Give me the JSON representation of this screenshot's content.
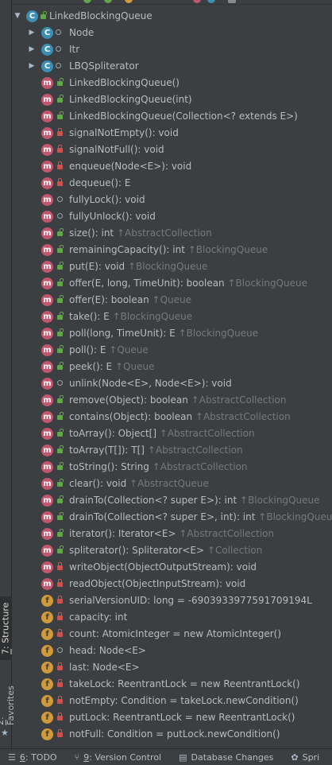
{
  "side_tabs": {
    "structure": {
      "num": "7",
      "label": ": Structure"
    },
    "favorites": {
      "num": "2",
      "label": ": Favorites"
    }
  },
  "root": {
    "label": "LinkedBlockingQueue"
  },
  "nested": [
    {
      "label": "Node",
      "badge": "C"
    },
    {
      "label": "Itr",
      "badge": "C"
    },
    {
      "label": "LBQSpliterator",
      "badge": "C"
    }
  ],
  "members": [
    {
      "kind": "m",
      "vis": "pub",
      "text": "LinkedBlockingQueue()",
      "inherit": ""
    },
    {
      "kind": "m",
      "vis": "pub",
      "text": "LinkedBlockingQueue(int)",
      "inherit": ""
    },
    {
      "kind": "m",
      "vis": "pub",
      "text": "LinkedBlockingQueue(Collection<? extends E>)",
      "inherit": ""
    },
    {
      "kind": "m",
      "vis": "priv",
      "text": "signalNotEmpty(): void",
      "inherit": ""
    },
    {
      "kind": "m",
      "vis": "priv",
      "text": "signalNotFull(): void",
      "inherit": ""
    },
    {
      "kind": "m",
      "vis": "priv",
      "text": "enqueue(Node<E>): void",
      "inherit": ""
    },
    {
      "kind": "m",
      "vis": "priv",
      "text": "dequeue(): E",
      "inherit": ""
    },
    {
      "kind": "m",
      "vis": "pkg",
      "text": "fullyLock(): void",
      "inherit": ""
    },
    {
      "kind": "m",
      "vis": "pkg",
      "text": "fullyUnlock(): void",
      "inherit": ""
    },
    {
      "kind": "m",
      "vis": "pub",
      "text": "size(): int",
      "inherit": "↑AbstractCollection"
    },
    {
      "kind": "m",
      "vis": "pub",
      "text": "remainingCapacity(): int",
      "inherit": "↑BlockingQueue"
    },
    {
      "kind": "m",
      "vis": "pub",
      "text": "put(E): void",
      "inherit": "↑BlockingQueue"
    },
    {
      "kind": "m",
      "vis": "pub",
      "text": "offer(E, long, TimeUnit): boolean",
      "inherit": "↑BlockingQueue"
    },
    {
      "kind": "m",
      "vis": "pub",
      "text": "offer(E): boolean",
      "inherit": "↑Queue"
    },
    {
      "kind": "m",
      "vis": "pub",
      "text": "take(): E",
      "inherit": "↑BlockingQueue"
    },
    {
      "kind": "m",
      "vis": "pub",
      "text": "poll(long, TimeUnit): E",
      "inherit": "↑BlockingQueue"
    },
    {
      "kind": "m",
      "vis": "pub",
      "text": "poll(): E",
      "inherit": "↑Queue"
    },
    {
      "kind": "m",
      "vis": "pub",
      "text": "peek(): E",
      "inherit": "↑Queue"
    },
    {
      "kind": "m",
      "vis": "pkg",
      "text": "unlink(Node<E>, Node<E>): void",
      "inherit": ""
    },
    {
      "kind": "m",
      "vis": "pub",
      "text": "remove(Object): boolean",
      "inherit": "↑AbstractCollection"
    },
    {
      "kind": "m",
      "vis": "pub",
      "text": "contains(Object): boolean",
      "inherit": "↑AbstractCollection"
    },
    {
      "kind": "m",
      "vis": "pub",
      "text": "toArray(): Object[]",
      "inherit": "↑AbstractCollection"
    },
    {
      "kind": "m",
      "vis": "pub",
      "text": "toArray(T[]): T[]",
      "inherit": "↑AbstractCollection"
    },
    {
      "kind": "m",
      "vis": "pub",
      "text": "toString(): String",
      "inherit": "↑AbstractCollection"
    },
    {
      "kind": "m",
      "vis": "pub",
      "text": "clear(): void",
      "inherit": "↑AbstractQueue"
    },
    {
      "kind": "m",
      "vis": "pub",
      "text": "drainTo(Collection<? super E>): int",
      "inherit": "↑BlockingQueue"
    },
    {
      "kind": "m",
      "vis": "pub",
      "text": "drainTo(Collection<? super E>, int): int",
      "inherit": "↑BlockingQueue"
    },
    {
      "kind": "m",
      "vis": "pub",
      "text": "iterator(): Iterator<E>",
      "inherit": "↑AbstractCollection"
    },
    {
      "kind": "m",
      "vis": "pub",
      "text": "spliterator(): Spliterator<E>",
      "inherit": "↑Collection"
    },
    {
      "kind": "m",
      "vis": "priv",
      "text": "writeObject(ObjectOutputStream): void",
      "inherit": ""
    },
    {
      "kind": "m",
      "vis": "priv",
      "text": "readObject(ObjectInputStream): void",
      "inherit": ""
    },
    {
      "kind": "f",
      "vis": "priv",
      "text": "serialVersionUID: long = -6903933977591709194L",
      "inherit": ""
    },
    {
      "kind": "f",
      "vis": "priv",
      "text": "capacity: int",
      "inherit": ""
    },
    {
      "kind": "f",
      "vis": "priv",
      "text": "count: AtomicInteger = new AtomicInteger()",
      "inherit": ""
    },
    {
      "kind": "f",
      "vis": "pkg",
      "text": "head: Node<E>",
      "inherit": ""
    },
    {
      "kind": "f",
      "vis": "priv",
      "text": "last: Node<E>",
      "inherit": ""
    },
    {
      "kind": "f",
      "vis": "priv",
      "text": "takeLock: ReentrantLock = new ReentrantLock()",
      "inherit": ""
    },
    {
      "kind": "f",
      "vis": "priv",
      "text": "notEmpty: Condition = takeLock.newCondition()",
      "inherit": ""
    },
    {
      "kind": "f",
      "vis": "priv",
      "text": "putLock: ReentrantLock = new ReentrantLock()",
      "inherit": ""
    },
    {
      "kind": "f",
      "vis": "priv",
      "text": "notFull: Condition = putLock.newCondition()",
      "inherit": ""
    }
  ],
  "bottom_bar": [
    {
      "icon": "list-icon",
      "num": "6",
      "label": ": TODO"
    },
    {
      "icon": "branch-icon",
      "num": "9",
      "label": ": Version Control"
    },
    {
      "icon": "database-icon",
      "num": "",
      "label": "Database Changes"
    },
    {
      "icon": "spring-icon",
      "num": "",
      "label": "Spri"
    }
  ],
  "colors": {
    "background": "#3c3f41",
    "class_badge": "#3b8fb5",
    "method_badge": "#c1566d",
    "field_badge": "#d09a3c",
    "public": "#62a64a",
    "private": "#c75450",
    "inherited_text": "#787878"
  }
}
